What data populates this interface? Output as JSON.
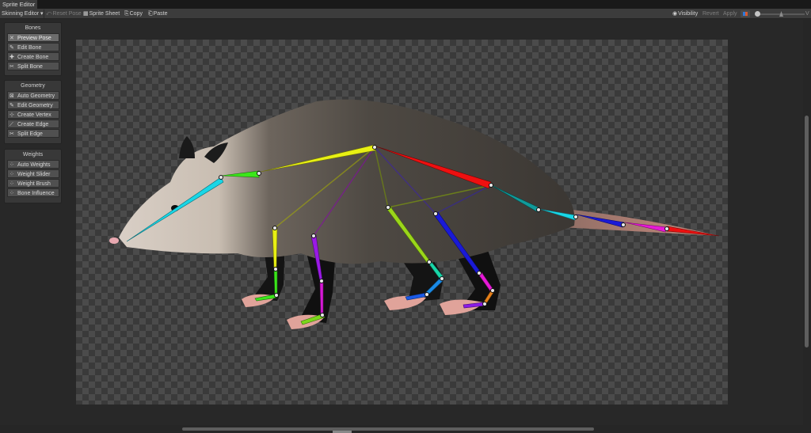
{
  "window": {
    "tab_title": "Sprite Editor"
  },
  "toolbar": {
    "mode_dropdown": "Skinning Editor",
    "reset_pose": "Reset Pose",
    "sprite_sheet": "Sprite Sheet",
    "copy": "Copy",
    "paste": "Paste",
    "visibility": "Visibility",
    "revert": "Revert",
    "apply": "Apply",
    "zoom_label": "V"
  },
  "panels": {
    "bones": {
      "title": "Bones",
      "buttons": [
        "Preview Pose",
        "Edit Bone",
        "Create Bone",
        "Split Bone"
      ],
      "active": "Preview Pose"
    },
    "geometry": {
      "title": "Geometry",
      "buttons": [
        "Auto Geometry",
        "Edit Geometry",
        "Create Vertex",
        "Create Edge",
        "Split Edge"
      ]
    },
    "weights": {
      "title": "Weights",
      "buttons": [
        "Auto Weights",
        "Weight Slider",
        "Weight Brush",
        "Bone Influence"
      ]
    }
  },
  "icons": {
    "bone_tools": "bone-icon",
    "geometry_tools": "mesh-icon",
    "weight_tools": "weights-grid-icon",
    "visibility": "eye-icon",
    "dropdown": "chevron-down-icon"
  },
  "colors": {
    "panel_bg": "#383838",
    "canvas_bg": "#282828",
    "active_button": "#6c6c6c"
  }
}
